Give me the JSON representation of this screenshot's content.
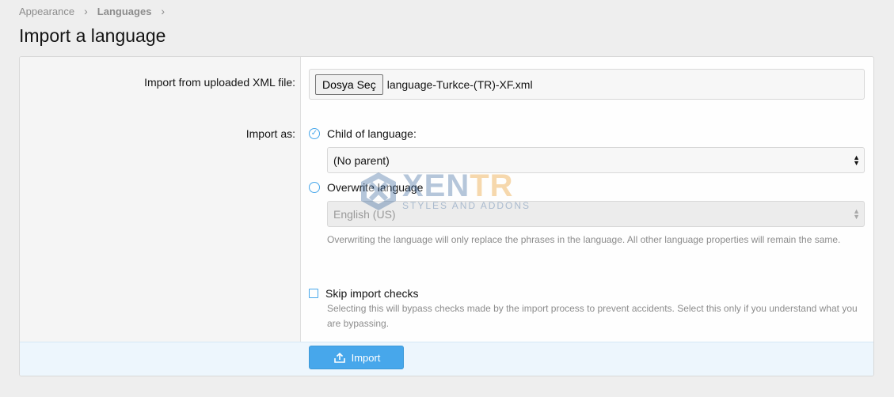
{
  "breadcrumb": {
    "items": [
      "Appearance",
      "Languages"
    ],
    "separator": "›"
  },
  "page_title": "Import a language",
  "form": {
    "upload": {
      "label": "Import from uploaded XML file:",
      "button_label": "Dosya Seç",
      "file_name": "language-Turkce-(TR)-XF.xml"
    },
    "import_as": {
      "label": "Import as:",
      "child_option": {
        "label": "Child of language:",
        "checked": true,
        "select_value": "(No parent)"
      },
      "overwrite_option": {
        "label": "Overwrite language",
        "checked": false,
        "select_value": "English (US)",
        "hint": "Overwriting the language will only replace the phrases in the language. All other language properties will remain the same."
      }
    },
    "skip_checks": {
      "label": "Skip import checks",
      "checked": false,
      "hint": "Selecting this will bypass checks made by the import process to prevent accidents. Select this only if you understand what you are bypassing."
    },
    "submit_label": "Import"
  },
  "watermark": {
    "main": "XEN",
    "accent": "TR",
    "sub": "STYLES AND ADDONS"
  },
  "colors": {
    "accent": "#47a7eb",
    "footer_bg": "#edf6fd",
    "label_bg": "#f5f5f5"
  }
}
